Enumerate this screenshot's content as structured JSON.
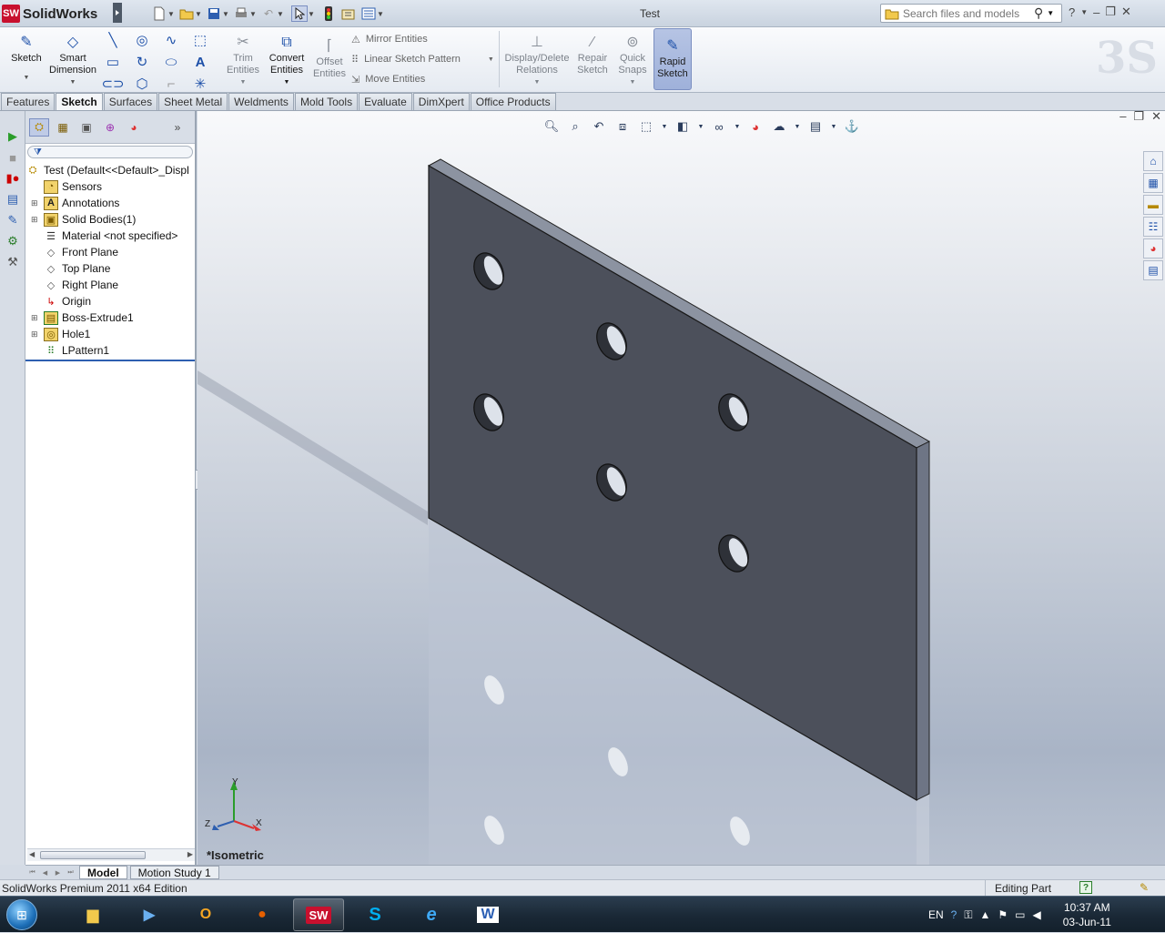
{
  "app": {
    "name": "SolidWorks",
    "doc_title": "Test"
  },
  "search": {
    "placeholder": "Search files and models"
  },
  "ribbon": {
    "sketch": "Sketch",
    "smart_dimension": [
      "Smart",
      "Dimension"
    ],
    "trim": [
      "Trim",
      "Entities"
    ],
    "convert": [
      "Convert",
      "Entities"
    ],
    "offset": [
      "Offset",
      "Entities"
    ],
    "mirror": "Mirror Entities",
    "linear_pattern": "Linear Sketch Pattern",
    "move": "Move Entities",
    "display_delete": [
      "Display/Delete",
      "Relations"
    ],
    "repair": [
      "Repair",
      "Sketch"
    ],
    "quick_snaps": [
      "Quick",
      "Snaps"
    ],
    "rapid_sketch": [
      "Rapid",
      "Sketch"
    ]
  },
  "tabs": [
    "Features",
    "Sketch",
    "Surfaces",
    "Sheet Metal",
    "Weldments",
    "Mold Tools",
    "Evaluate",
    "DimXpert",
    "Office Products"
  ],
  "active_tab": "Sketch",
  "tree": {
    "root": "Test  (Default<<Default>_Displ",
    "items": [
      {
        "label": "Sensors",
        "icon": "sensor-icon"
      },
      {
        "label": "Annotations",
        "icon": "annotation-icon"
      },
      {
        "label": "Solid Bodies(1)",
        "icon": "solid-bodies-icon"
      },
      {
        "label": "Material <not specified>",
        "icon": "material-icon"
      },
      {
        "label": "Front Plane",
        "icon": "plane-icon"
      },
      {
        "label": "Top Plane",
        "icon": "plane-icon"
      },
      {
        "label": "Right Plane",
        "icon": "plane-icon"
      },
      {
        "label": "Origin",
        "icon": "origin-icon"
      },
      {
        "label": "Boss-Extrude1",
        "icon": "extrude-icon"
      },
      {
        "label": "Hole1",
        "icon": "hole-icon"
      },
      {
        "label": "LPattern1",
        "icon": "pattern-icon"
      }
    ]
  },
  "viewport": {
    "view_label": "*Isometric",
    "axis": {
      "x": "X",
      "y": "Y",
      "z": "Z"
    }
  },
  "bottom_tabs": [
    "Model",
    "Motion Study 1"
  ],
  "status": {
    "edition": "SolidWorks Premium 2011 x64 Edition",
    "mode": "Editing Part",
    "help": "?"
  },
  "taskbar": {
    "lang": "EN",
    "time": "10:37 AM",
    "date": "03-Jun-11"
  }
}
